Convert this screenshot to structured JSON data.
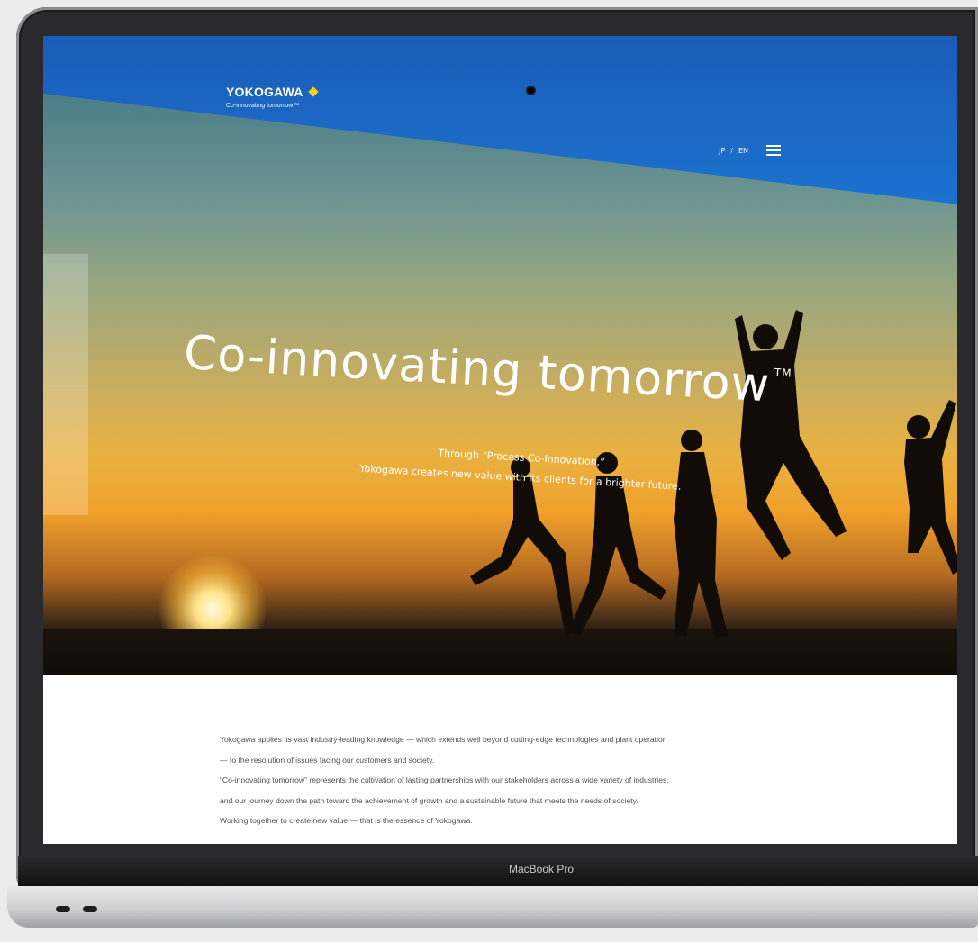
{
  "device": {
    "label": "MacBook Pro"
  },
  "header": {
    "logo_text": "YOKOGAWA",
    "tagline": "Co-innovating tomorrow™",
    "lang_jp": "JP",
    "lang_sep": "/",
    "lang_en": "EN",
    "menu_icon": "hamburger-menu-icon"
  },
  "hero": {
    "title": "Co-innovating tomorrow",
    "title_mark": "TM",
    "subtitle_line1": "Through “Process Co-Innovation,”",
    "subtitle_line2": "Yokogawa creates new value with its clients for a brighter future."
  },
  "carousel": {
    "prev": "‹",
    "next": "›",
    "slide_count": 4,
    "active_index": 0
  },
  "body": {
    "lines": [
      "Yokogawa applies its vast industry-leading knowledge — which extends well beyond cutting-edge technologies and plant operation",
      "— to the resolution of issues facing our customers and society.",
      "“Co-innovating tomorrow” represents the cultivation of lasting partnerships with our stakeholders across a wide variety of industries,",
      "and our journey down the path toward the achievement of growth and a sustainable future that meets the needs of society.",
      "Working together to create new value — that is the essence of Yokogawa."
    ]
  },
  "colors": {
    "header_blue": "#1c6ac6",
    "logo_diamond": "#f2d21b"
  }
}
